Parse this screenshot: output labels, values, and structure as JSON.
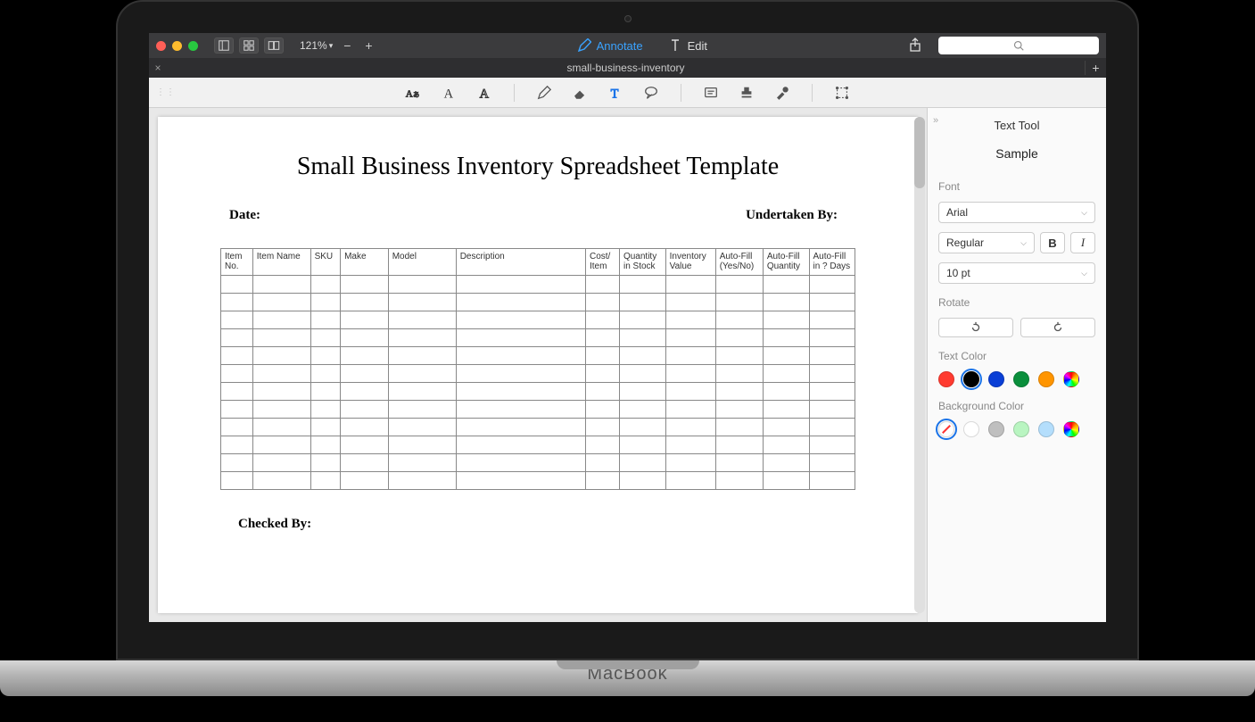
{
  "titlebar": {
    "zoom": "121%",
    "annotate": "Annotate",
    "edit": "Edit"
  },
  "tab": {
    "title": "small-business-inventory"
  },
  "document": {
    "title": "Small Business Inventory Spreadsheet Template",
    "date_label": "Date:",
    "undertaken_label": "Undertaken By:",
    "checked_label": "Checked By:",
    "columns": [
      "Item No.",
      "Item Name",
      "SKU",
      "Make",
      "Model",
      "Description",
      "Cost/ Item",
      "Quantity in Stock",
      "Inventory Value",
      "Auto-Fill (Yes/No)",
      "Auto-Fill Quantity",
      "Auto-Fill in ? Days"
    ],
    "empty_rows": 12
  },
  "panel": {
    "title": "Text Tool",
    "sample": "Sample",
    "font_label": "Font",
    "font_value": "Arial",
    "weight_value": "Regular",
    "bold": "B",
    "italic": "I",
    "size_value": "10 pt",
    "rotate_label": "Rotate",
    "text_color_label": "Text Color",
    "text_colors": [
      "#ff3b30",
      "#000000",
      "#0a3fd6",
      "#0a8f3c",
      "#ff9500"
    ],
    "text_color_selected": 1,
    "bg_label": "Background Color",
    "bg_colors": [
      "#ffffff",
      "#bfbfbf",
      "#b9f5c1",
      "#b4defc"
    ],
    "bg_selected_none": true
  }
}
